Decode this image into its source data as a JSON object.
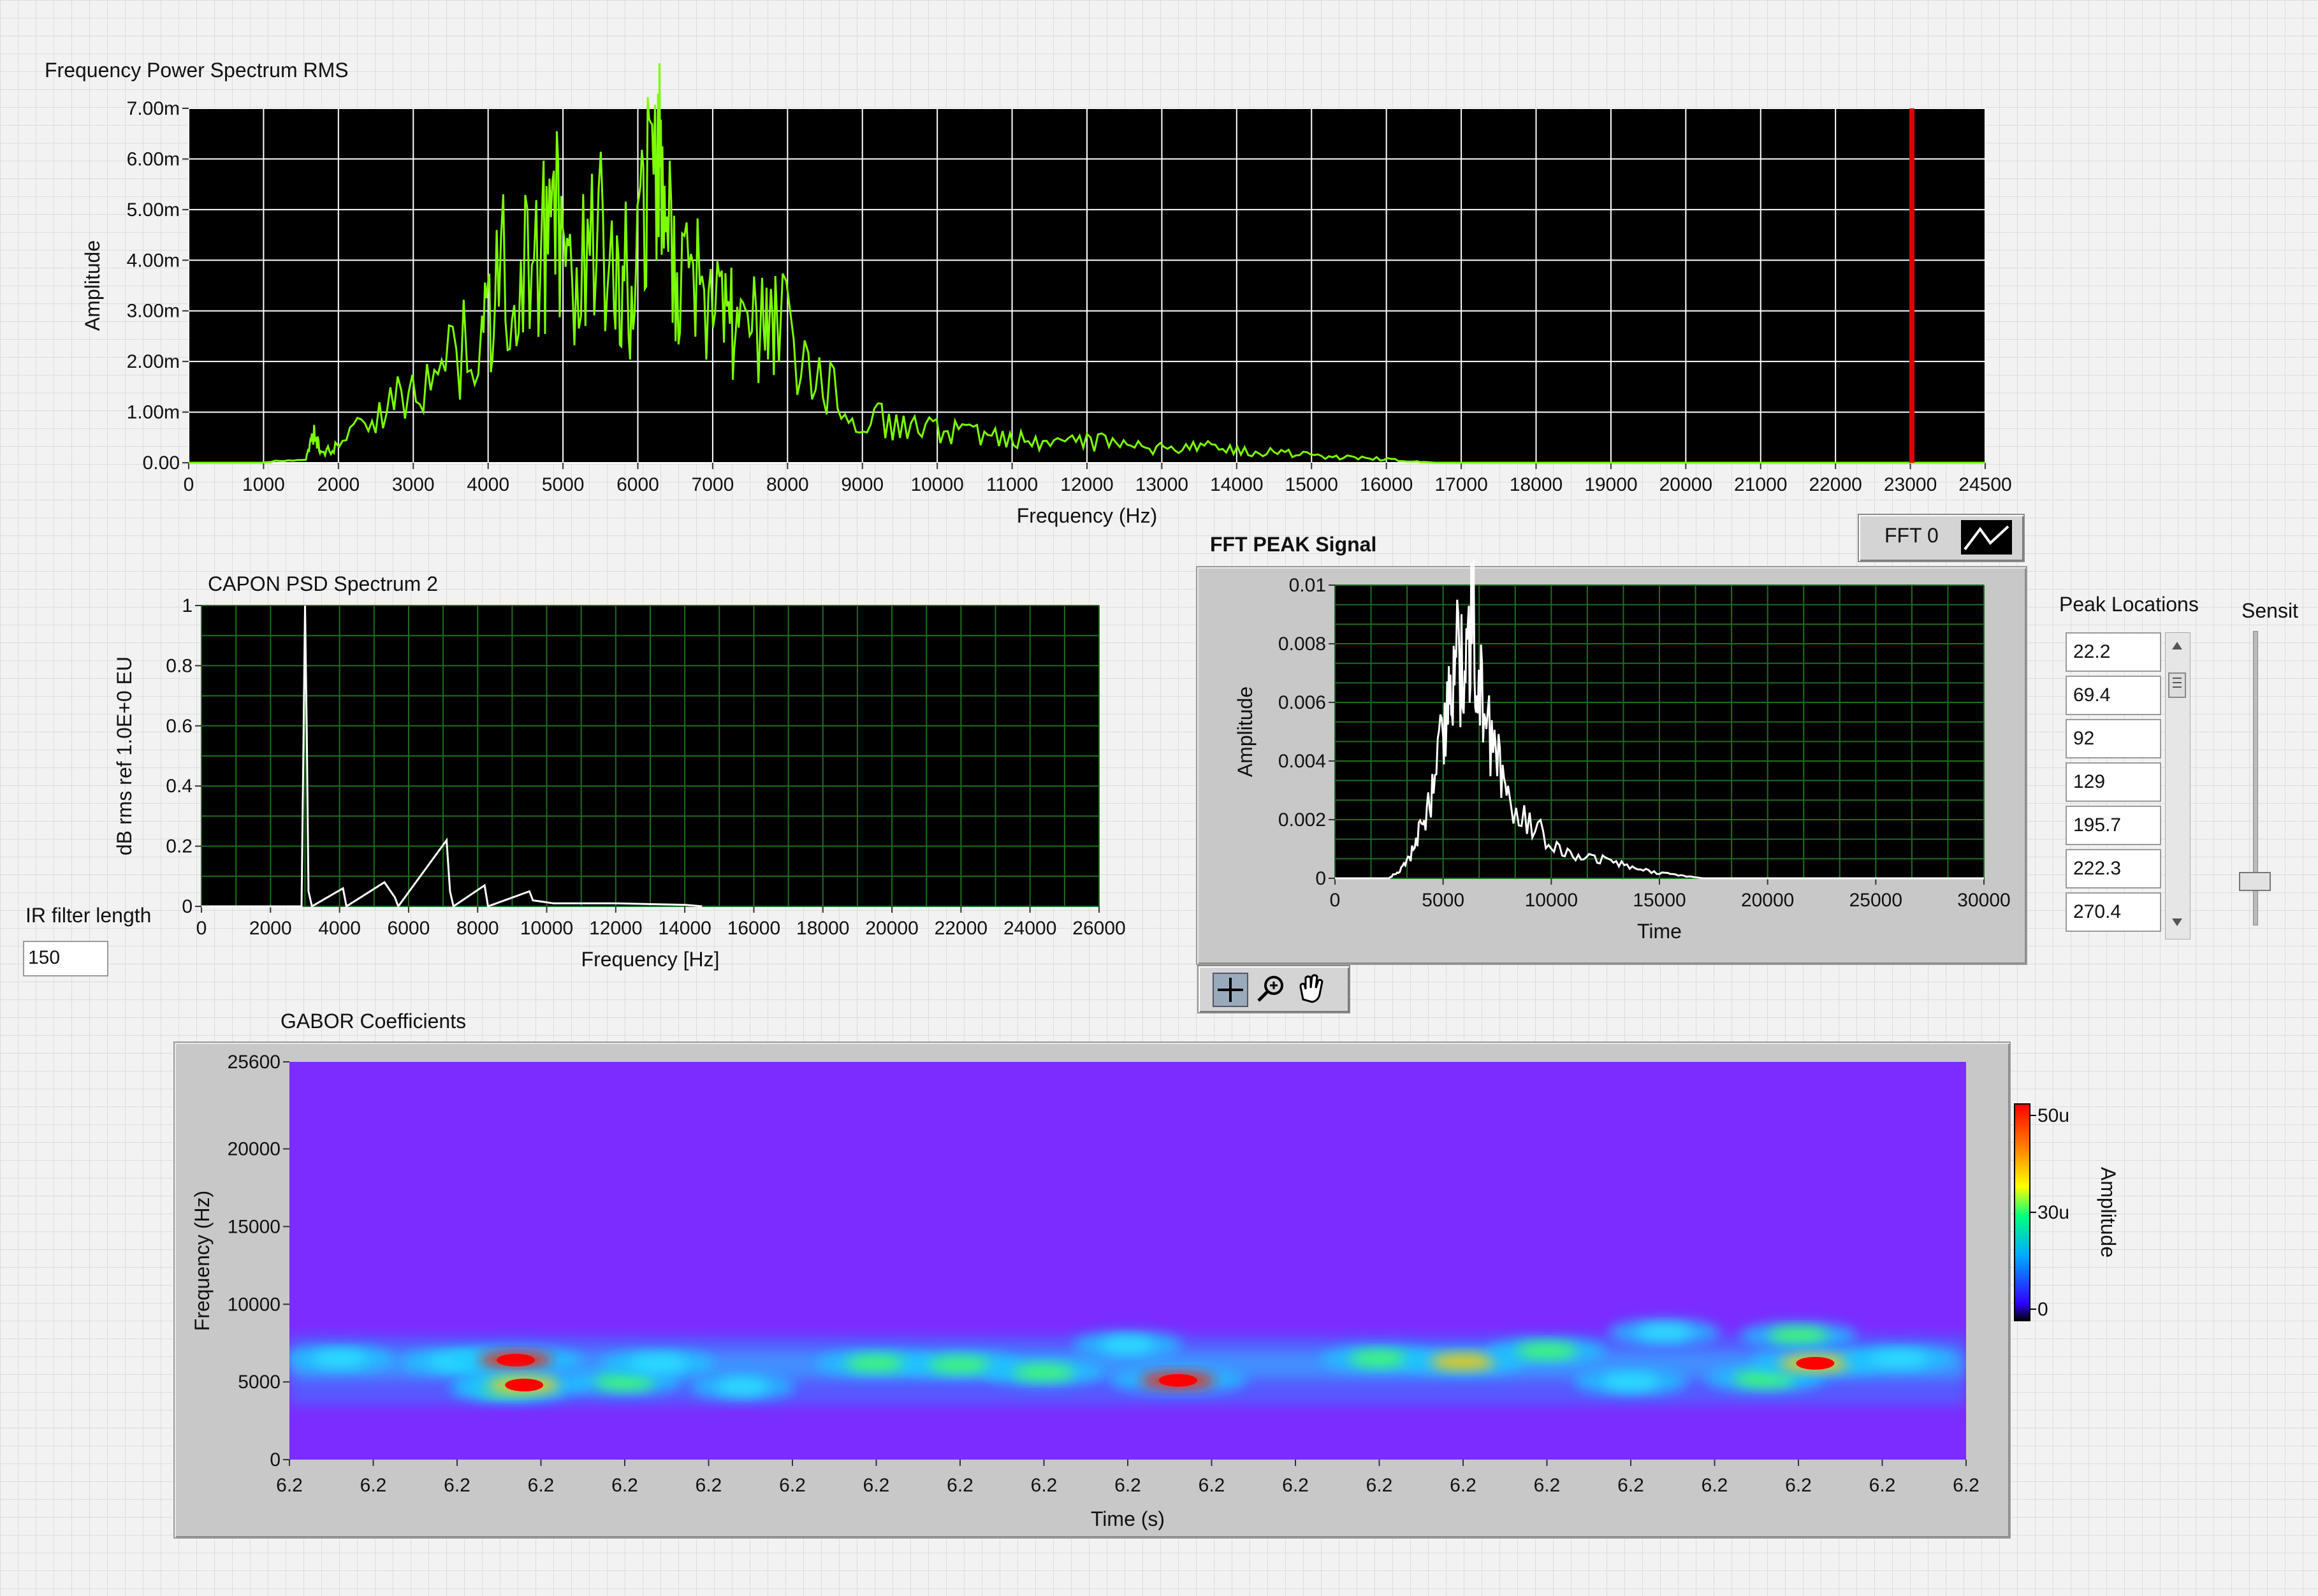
{
  "colors": {
    "spectrum_trace": "#7cff00",
    "cursor": "#e00000",
    "grid_white": "#ffffff",
    "grid_green": "#1f6e1f",
    "trace_white": "#ffffff",
    "gabor_background": "#7b2cff"
  },
  "fft_power": {
    "title": "Frequency Power Spectrum RMS",
    "chart_data": {
      "type": "line",
      "title": "Frequency Power Spectrum RMS",
      "xlabel": "Frequency (Hz)",
      "ylabel": "Amplitude",
      "xlim": [
        0,
        24500
      ],
      "ylim": [
        0,
        0.007
      ],
      "grid": true,
      "x_ticks": [
        "0",
        "1000",
        "2000",
        "3000",
        "4000",
        "5000",
        "6000",
        "7000",
        "8000",
        "9000",
        "10000",
        "11000",
        "12000",
        "13000",
        "14000",
        "15000",
        "16000",
        "17000",
        "18000",
        "19000",
        "20000",
        "21000",
        "22000",
        "23000",
        "24500"
      ],
      "y_ticks": [
        "0.00",
        "1.00m",
        "2.00m",
        "3.00m",
        "4.00m",
        "5.00m",
        "6.00m",
        "7.00m"
      ],
      "series": [
        {
          "x": [
            0,
            1000,
            1600,
            1700,
            1800,
            2000,
            2500,
            3000,
            3500,
            4000,
            4200,
            4500,
            4800,
            5000,
            5200,
            5500,
            5800,
            6000,
            6200,
            6400,
            6500,
            6700,
            7000,
            7300,
            7500,
            7800,
            8000,
            8500,
            9000,
            9500,
            10000,
            10500,
            11000,
            11500,
            12000,
            12500,
            13000,
            13500,
            14000,
            14500,
            15000,
            15500,
            16000,
            16500,
            17000,
            18000,
            20000,
            22000,
            24500
          ],
          "y": [
            0,
            0,
            0.0001,
            0.0006,
            0.0002,
            0.0003,
            0.0009,
            0.0015,
            0.0021,
            0.0025,
            0.0036,
            0.0039,
            0.0041,
            0.0052,
            0.0038,
            0.0045,
            0.004,
            0.0035,
            0.005,
            0.0058,
            0.0045,
            0.0042,
            0.0033,
            0.0027,
            0.0029,
            0.0025,
            0.0031,
            0.0018,
            0.001,
            0.0008,
            0.0007,
            0.0006,
            0.0005,
            0.0004,
            0.0004,
            0.0004,
            0.0003,
            0.0003,
            0.0003,
            0.0002,
            0.0002,
            0.0001,
            0.0001,
            5e-05,
            0,
            0,
            0,
            0,
            0
          ]
        }
      ],
      "cursor_x": 23500
    }
  },
  "fft_legend": {
    "label": "FFT 0"
  },
  "capon": {
    "title": "CAPON PSD Spectrum 2",
    "chart_data": {
      "type": "line",
      "title": "CAPON PSD Spectrum 2",
      "xlabel": "Frequency [Hz]",
      "ylabel": "dB rms ref 1.0E+0 EU",
      "xlim": [
        0,
        26000
      ],
      "ylim": [
        0,
        1
      ],
      "grid": true,
      "x_ticks": [
        "0",
        "2000",
        "4000",
        "6000",
        "8000",
        "10000",
        "12000",
        "14000",
        "16000",
        "18000",
        "20000",
        "22000",
        "24000",
        "26000"
      ],
      "y_ticks": [
        "0",
        "0.2",
        "0.4",
        "0.6",
        "0.8",
        "1"
      ],
      "series": [
        {
          "x": [
            0,
            2900,
            3000,
            3050,
            3100,
            3200,
            4100,
            4200,
            5300,
            5600,
            5700,
            7100,
            7200,
            7300,
            8200,
            8300,
            9500,
            9600,
            10200,
            12000,
            14000,
            14500
          ],
          "y": [
            0,
            0,
            1.0,
            0.58,
            0.05,
            0,
            0.06,
            0,
            0.08,
            0.03,
            0,
            0.22,
            0.05,
            0,
            0.07,
            0,
            0.05,
            0.02,
            0.01,
            0.01,
            0.005,
            0
          ]
        }
      ]
    }
  },
  "fir": {
    "label": "IR filter length",
    "value": "150"
  },
  "fft_peak": {
    "title": "FFT  PEAK Signal",
    "chart_data": {
      "type": "line",
      "title": "FFT  PEAK Signal",
      "xlabel": "Time",
      "ylabel": "Amplitude",
      "xlim": [
        0,
        30000
      ],
      "ylim": [
        0,
        0.01
      ],
      "grid": true,
      "x_ticks": [
        "0",
        "5000",
        "10000",
        "15000",
        "20000",
        "25000",
        "30000"
      ],
      "y_ticks": [
        "0",
        "0.002",
        "0.004",
        "0.006",
        "0.008",
        "0.01"
      ],
      "series": [
        {
          "x": [
            0,
            2500,
            3000,
            3500,
            4000,
            4500,
            5000,
            5300,
            5600,
            6000,
            6300,
            6600,
            7000,
            7500,
            8000,
            9000,
            10000,
            11000,
            12000,
            13000,
            14000,
            15000,
            16000,
            17000,
            30000
          ],
          "y": [
            0,
            0,
            0.0003,
            0.0008,
            0.0017,
            0.0029,
            0.0051,
            0.0062,
            0.0083,
            0.0064,
            0.0091,
            0.0073,
            0.0052,
            0.0043,
            0.0028,
            0.0019,
            0.0012,
            0.0009,
            0.0007,
            0.0005,
            0.0003,
            0.0002,
            0.0001,
            0,
            0
          ]
        }
      ]
    }
  },
  "graph_palette": {
    "items": [
      "cursor-tool",
      "zoom-tool",
      "pan-tool"
    ]
  },
  "peaks": {
    "label": "Peak Locations",
    "values": [
      "22.2",
      "69.4",
      "92",
      "129",
      "195.7",
      "222.3",
      "270.4"
    ]
  },
  "sensitivity": {
    "label": "Sensit",
    "level": 0.1
  },
  "gabor": {
    "title": "GABOR Coefficients",
    "chart_data": {
      "type": "heatmap",
      "title": "GABOR Coefficients",
      "xlabel": "Time (s)",
      "ylabel": "Frequency (Hz)",
      "ylim": [
        0,
        25600
      ],
      "x_ticks": [
        "6.2",
        "6.2",
        "6.2",
        "6.2",
        "6.2",
        "6.2",
        "6.2",
        "6.2",
        "6.2",
        "6.2",
        "6.2",
        "6.2",
        "6.2",
        "6.2",
        "6.2",
        "6.2",
        "6.2",
        "6.2",
        "6.2",
        "6.2",
        "6.2"
      ],
      "y_ticks": [
        "0",
        "5000",
        "10000",
        "15000",
        "20000",
        "25600"
      ],
      "colorbar": {
        "label": "Amplitude",
        "ticks": [
          "50u",
          "30u",
          "0"
        ],
        "range": [
          0,
          5e-05
        ]
      },
      "blobs": [
        {
          "t": 0.03,
          "f": 6500,
          "v": 0.4
        },
        {
          "t": 0.1,
          "f": 6300,
          "v": 0.45
        },
        {
          "t": 0.13,
          "f": 4600,
          "v": 0.55
        },
        {
          "t": 0.135,
          "f": 6400,
          "v": 0.9
        },
        {
          "t": 0.14,
          "f": 4800,
          "v": 0.85
        },
        {
          "t": 0.2,
          "f": 5000,
          "v": 0.55
        },
        {
          "t": 0.22,
          "f": 6200,
          "v": 0.5
        },
        {
          "t": 0.27,
          "f": 4700,
          "v": 0.35
        },
        {
          "t": 0.35,
          "f": 6200,
          "v": 0.6
        },
        {
          "t": 0.4,
          "f": 6100,
          "v": 0.65
        },
        {
          "t": 0.45,
          "f": 5600,
          "v": 0.6
        },
        {
          "t": 0.53,
          "f": 5100,
          "v": 0.95
        },
        {
          "t": 0.5,
          "f": 7400,
          "v": 0.4
        },
        {
          "t": 0.65,
          "f": 6500,
          "v": 0.55
        },
        {
          "t": 0.7,
          "f": 6300,
          "v": 0.7
        },
        {
          "t": 0.75,
          "f": 7000,
          "v": 0.6
        },
        {
          "t": 0.8,
          "f": 5000,
          "v": 0.5
        },
        {
          "t": 0.82,
          "f": 8200,
          "v": 0.45
        },
        {
          "t": 0.88,
          "f": 5200,
          "v": 0.6
        },
        {
          "t": 0.9,
          "f": 8000,
          "v": 0.55
        },
        {
          "t": 0.91,
          "f": 6200,
          "v": 0.85
        },
        {
          "t": 0.96,
          "f": 6500,
          "v": 0.5
        }
      ]
    }
  }
}
